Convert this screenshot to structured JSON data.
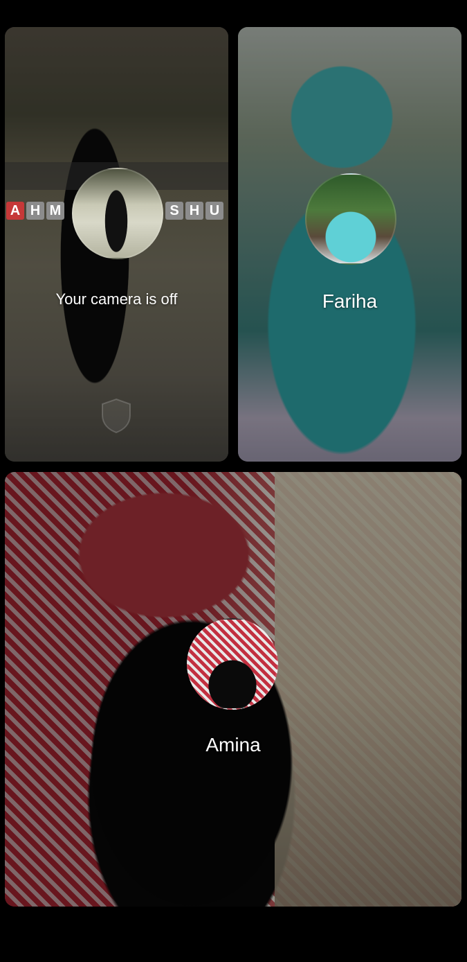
{
  "participants": [
    {
      "id": "self",
      "label": "Your camera is off",
      "camera": "off"
    },
    {
      "id": "fariha",
      "label": "Fariha"
    },
    {
      "id": "amina",
      "label": "Amina"
    }
  ],
  "self_overlay": {
    "letters_left": [
      "A",
      "H",
      "M"
    ],
    "letters_right": [
      "S",
      "H",
      "U"
    ]
  },
  "icons": {
    "watermark": "shield-icon"
  },
  "colors": {
    "background": "#000000",
    "text": "#ffffff",
    "letter_highlight": "#c63838"
  }
}
